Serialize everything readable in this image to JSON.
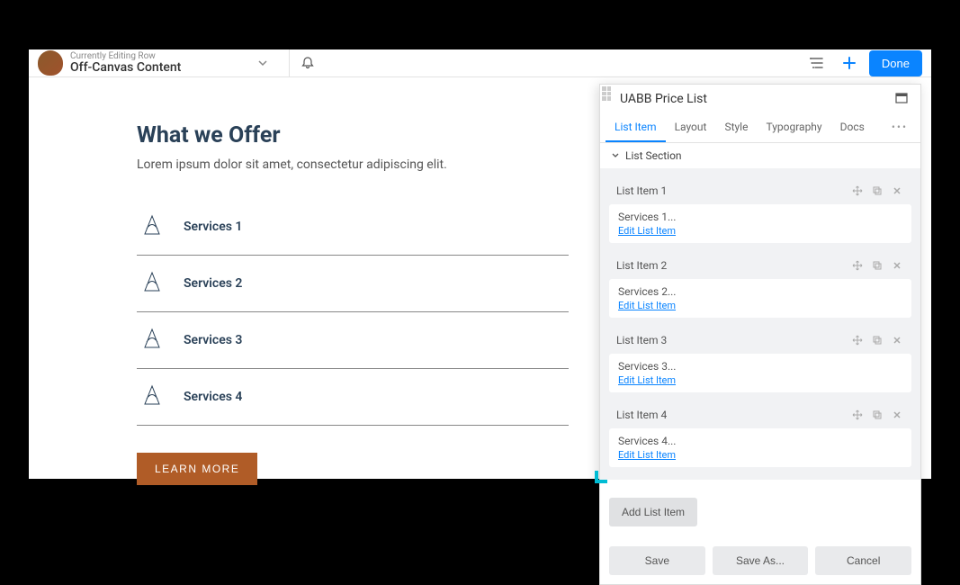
{
  "topbar": {
    "editing_label": "Currently Editing Row",
    "editing_name": "Off-Canvas Content",
    "done_label": "Done"
  },
  "page": {
    "title": "What we Offer",
    "subtitle": "Lorem ipsum dolor sit amet, consectetur adipiscing elit.",
    "services": [
      {
        "label": "Services 1"
      },
      {
        "label": "Services 2"
      },
      {
        "label": "Services 3"
      },
      {
        "label": "Services 4"
      }
    ],
    "learn_more_label": "LEARN MORE"
  },
  "panel": {
    "title": "UABB Price List",
    "tabs": [
      "List Item",
      "Layout",
      "Style",
      "Typography",
      "Docs"
    ],
    "active_tab": 0,
    "section_label": "List Section",
    "items": [
      {
        "header": "List Item 1",
        "text": "Services 1...",
        "link": "Edit List Item"
      },
      {
        "header": "List Item 2",
        "text": "Services 2...",
        "link": "Edit List Item"
      },
      {
        "header": "List Item 3",
        "text": "Services 3...",
        "link": "Edit List Item"
      },
      {
        "header": "List Item 4",
        "text": "Services 4...",
        "link": "Edit List Item"
      }
    ],
    "add_label": "Add List Item",
    "footer": {
      "save": "Save",
      "save_as": "Save As...",
      "cancel": "Cancel"
    }
  }
}
